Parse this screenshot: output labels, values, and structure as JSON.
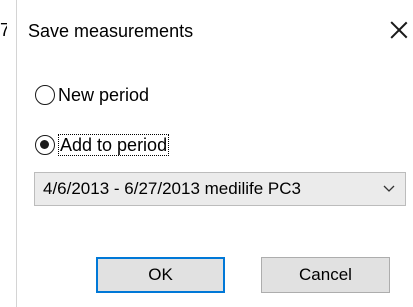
{
  "edge_fragment": "7",
  "dialog": {
    "title": "Save measurements",
    "close_icon": "close-icon"
  },
  "options": {
    "new_period": {
      "label": "New period",
      "checked": false
    },
    "add_to_period": {
      "label": "Add to period",
      "checked": true
    }
  },
  "period_select": {
    "value": "4/6/2013 - 6/27/2013 medilife PC3",
    "icon": "chevron-down-icon"
  },
  "buttons": {
    "ok_label": "OK",
    "cancel_label": "Cancel"
  },
  "colors": {
    "accent": "#0078d7",
    "button_bg": "#e1e1e1",
    "select_bg": "#ebebeb"
  }
}
